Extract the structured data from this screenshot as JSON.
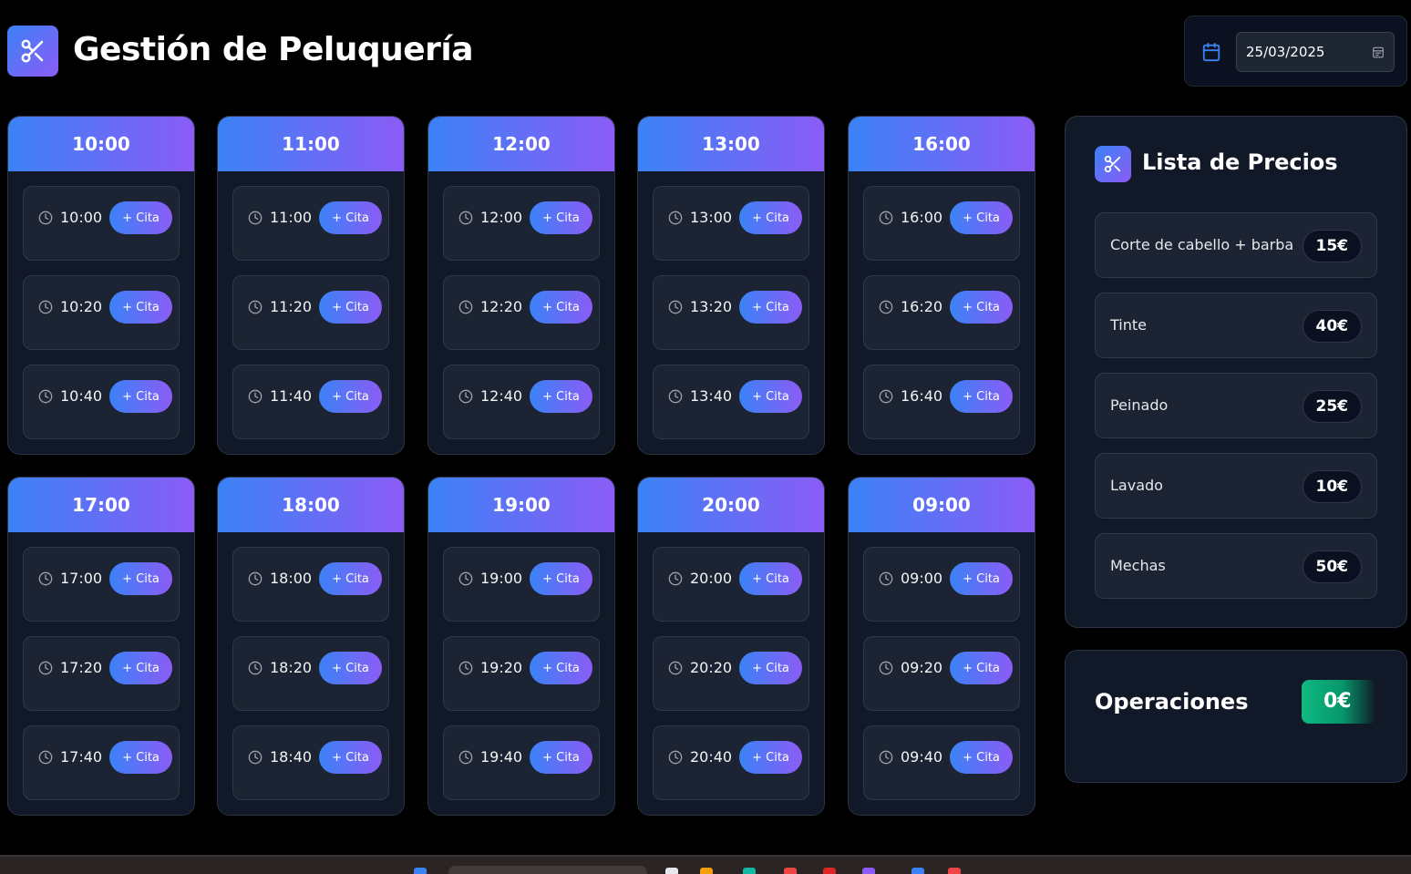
{
  "header": {
    "title": "Gestión de Peluquería",
    "date": "25/03/2025"
  },
  "hours": [
    {
      "label": "10:00",
      "slots": [
        {
          "time": "10:00"
        },
        {
          "time": "10:20"
        },
        {
          "time": "10:40"
        }
      ]
    },
    {
      "label": "11:00",
      "slots": [
        {
          "time": "11:00"
        },
        {
          "time": "11:20"
        },
        {
          "time": "11:40"
        }
      ]
    },
    {
      "label": "12:00",
      "slots": [
        {
          "time": "12:00"
        },
        {
          "time": "12:20"
        },
        {
          "time": "12:40"
        }
      ]
    },
    {
      "label": "13:00",
      "slots": [
        {
          "time": "13:00"
        },
        {
          "time": "13:20"
        },
        {
          "time": "13:40"
        }
      ]
    },
    {
      "label": "16:00",
      "slots": [
        {
          "time": "16:00"
        },
        {
          "time": "16:20"
        },
        {
          "time": "16:40"
        }
      ]
    },
    {
      "label": "17:00",
      "slots": [
        {
          "time": "17:00"
        },
        {
          "time": "17:20"
        },
        {
          "time": "17:40"
        }
      ]
    },
    {
      "label": "18:00",
      "slots": [
        {
          "time": "18:00"
        },
        {
          "time": "18:20"
        },
        {
          "time": "18:40"
        }
      ]
    },
    {
      "label": "19:00",
      "slots": [
        {
          "time": "19:00"
        },
        {
          "time": "19:20"
        },
        {
          "time": "19:40"
        }
      ]
    },
    {
      "label": "20:00",
      "slots": [
        {
          "time": "20:00"
        },
        {
          "time": "20:20"
        },
        {
          "time": "20:40"
        }
      ]
    },
    {
      "label": "09:00",
      "slots": [
        {
          "time": "09:00"
        },
        {
          "time": "09:20"
        },
        {
          "time": "09:40"
        }
      ]
    }
  ],
  "cita_label": "+ Cita",
  "prices": {
    "title": "Lista de Precios",
    "items": [
      {
        "service": "Corte de cabello + barba",
        "price": "15€"
      },
      {
        "service": "Tinte",
        "price": "40€"
      },
      {
        "service": "Peinado",
        "price": "25€"
      },
      {
        "service": "Lavado",
        "price": "10€"
      },
      {
        "service": "Mechas",
        "price": "50€"
      }
    ]
  },
  "operations": {
    "title": "Operaciones",
    "total": "0€"
  },
  "colors": {
    "accent_start": "#3b82f6",
    "accent_end": "#8b5cf6",
    "total_green": "#10b981",
    "panel_bg": "#111827"
  },
  "icons": {
    "logo": "scissors-icon",
    "date": "calendar-icon",
    "slot": "clock-icon"
  }
}
